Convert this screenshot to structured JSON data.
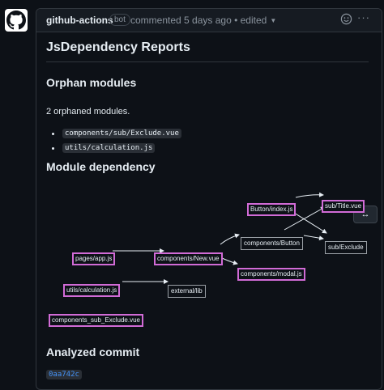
{
  "comment": {
    "author": "github-actions",
    "badge": "bot",
    "meta": "commented 5 days ago • edited",
    "menu": "···"
  },
  "report": {
    "title": "JsDependency Reports",
    "orphan_heading": "Orphan modules",
    "orphan_summary": "2 orphaned modules.",
    "orphans": [
      "components/sub/Exclude.vue",
      "utils/calculation.js"
    ],
    "dependency_heading": "Module dependency",
    "commit_heading": "Analyzed commit",
    "commit_sha": "0aa742c"
  },
  "graph": {
    "expand_icon": "↔",
    "nodes": {
      "button_index": "Button/index.js",
      "sub_title": "sub/Title.vue",
      "components_button": "components/Button",
      "sub_exclude": "sub/Exclude",
      "pages_app": "pages/app.js",
      "components_new": "components/New.vue",
      "components_modal": "components/modal.js",
      "utils_calc": "utils/calculation.js",
      "external_lib": "external/lib",
      "components_sub_exclude": "components_sub_Exclude.vue"
    },
    "edges": [
      [
        "pages_app",
        "components_new"
      ],
      [
        "components_new",
        "components_button"
      ],
      [
        "components_new",
        "components_modal"
      ],
      [
        "components_button",
        "sub_title"
      ],
      [
        "button_index",
        "sub_title"
      ],
      [
        "button_index",
        "sub_exclude"
      ],
      [
        "components_button",
        "sub_exclude"
      ],
      [
        "utils_calc",
        "external_lib"
      ]
    ]
  },
  "colors": {
    "background": "#0d1117",
    "highlight": "#d16bd6",
    "link": "#4493f8"
  }
}
